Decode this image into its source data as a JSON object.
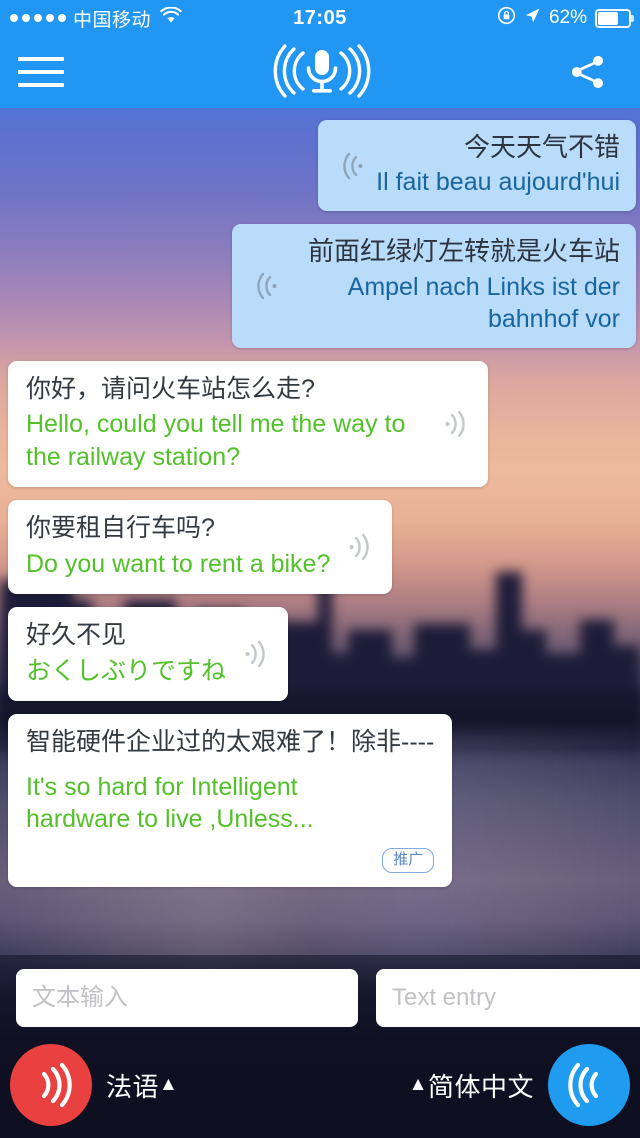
{
  "status_bar": {
    "signal_dots": 5,
    "carrier": "中国移动",
    "wifi_icon": "wifi-icon",
    "time": "17:05",
    "rotation_lock_icon": "rotation-lock-icon",
    "location_icon": "location-arrow-icon",
    "battery_percent": "62%",
    "battery_level": 62
  },
  "nav_bar": {
    "menu_icon": "hamburger-menu-icon",
    "logo_icon": "microphone-waves-icon",
    "share_icon": "share-icon",
    "accent_color": "#2196f3"
  },
  "chat": {
    "speaker_icon_incoming": "speaker-wave-left-icon",
    "speaker_icon_outgoing": "speaker-wave-right-icon",
    "messages": [
      {
        "side": "incoming",
        "source_text": "今天天气不错",
        "translated_text": "Il fait beau aujourd'hui"
      },
      {
        "side": "incoming",
        "source_text": "前面红绿灯左转就是火车站",
        "translated_text": "Ampel nach Links ist der bahnhof vor"
      },
      {
        "side": "outgoing",
        "source_text": "你好，请问火车站怎么走?",
        "translated_text": "Hello, could you tell me the way to the railway station?"
      },
      {
        "side": "outgoing",
        "source_text": "你要租自行车吗?",
        "translated_text": "Do you want to rent a bike?"
      },
      {
        "side": "outgoing",
        "source_text": "好久不见",
        "translated_text": "おくしぶりですね"
      },
      {
        "side": "outgoing",
        "source_text": "智能硬件企业过的太艰难了！除非----",
        "translated_text": "It's so hard for Intelligent hardware to live ,Unless...",
        "badge": "推广"
      }
    ],
    "bubble_incoming_color": "#badcfb",
    "bubble_outgoing_color": "#ffffff",
    "translated_incoming_color": "#19659e",
    "translated_outgoing_color": "#53c12a"
  },
  "bottom_bar": {
    "input_left_placeholder": "文本输入",
    "input_left_value": "",
    "input_right_placeholder": "Text entry",
    "input_right_value": "",
    "mic_left_icon": "mic-record-right-waves-icon",
    "mic_left_color": "#e8413f",
    "lang_left_label": "法语",
    "lang_left_caret": "▲",
    "lang_right_caret": "▲",
    "lang_right_label": "简体中文",
    "mic_right_icon": "mic-record-left-waves-icon",
    "mic_right_color": "#1f9bf0"
  }
}
